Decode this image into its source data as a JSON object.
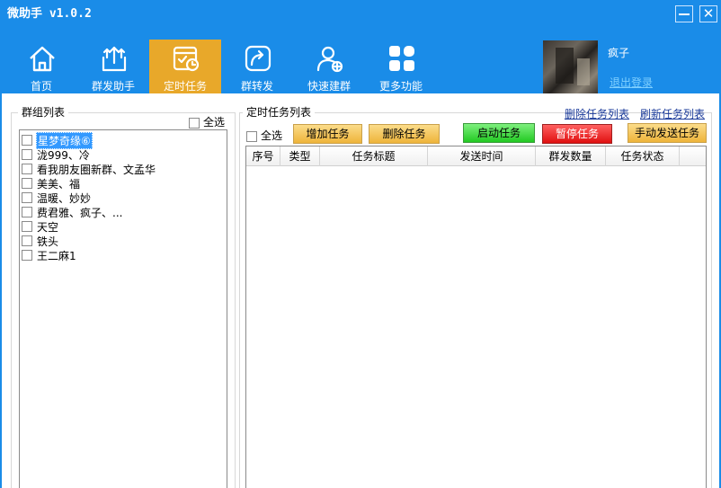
{
  "app": {
    "title": "微助手 v1.0.2"
  },
  "window_controls": {
    "minimize": "—",
    "close": "✕"
  },
  "nav": [
    {
      "label": "首页",
      "icon": "home-icon"
    },
    {
      "label": "群发助手",
      "icon": "broadcast-icon"
    },
    {
      "label": "定时任务",
      "icon": "scheduled-task-icon",
      "active": true
    },
    {
      "label": "群转发",
      "icon": "share-icon"
    },
    {
      "label": "快速建群",
      "icon": "add-group-icon"
    },
    {
      "label": "更多功能",
      "icon": "apps-grid-icon"
    }
  ],
  "user": {
    "name": "疯子",
    "logout": "退出登录"
  },
  "group_panel": {
    "title": "群组列表",
    "select_all": "全选",
    "items": [
      "星梦奇缘⑥",
      "泷999、冷",
      "看我朋友圈新群、文孟华",
      "美美、福",
      "温暖、妙妙",
      "费君雅、疯子、...",
      "天空",
      "铁头",
      "王二麻1"
    ]
  },
  "task_panel": {
    "title": "定时任务列表",
    "delete_list_link": "删除任务列表",
    "refresh_list_link": "刷新任务列表",
    "select_all": "全选",
    "buttons": {
      "add": "增加任务",
      "delete": "删除任务",
      "start": "启动任务",
      "pause": "暂停任务",
      "manual_send": "手动发送任务"
    },
    "columns": [
      "序号",
      "类型",
      "任务标题",
      "发送时间",
      "群发数量",
      "任务状态"
    ]
  },
  "colors": {
    "header_blue": "#1a8ce8",
    "active_tab": "#e8a82a",
    "start_green": "#22c922",
    "pause_red": "#e01010",
    "selection_blue": "#3399ff"
  }
}
